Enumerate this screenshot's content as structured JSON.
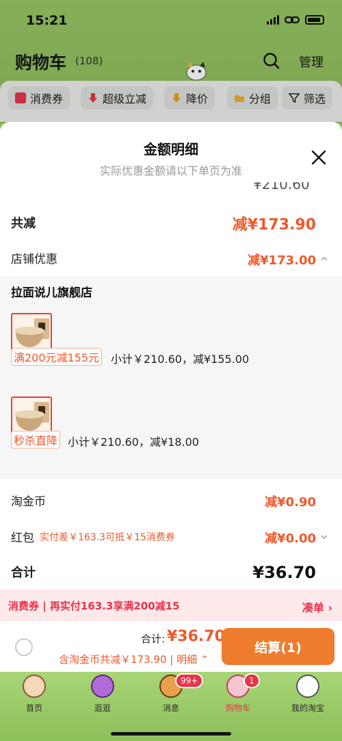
{
  "status": {
    "time": "15:21"
  },
  "header": {
    "title": "购物车",
    "count": "(108)",
    "manage": "管理"
  },
  "filters": [
    {
      "label": "消费券",
      "icon": "coupon-icon"
    },
    {
      "label": "超级立减",
      "icon": "arrow-down-icon"
    },
    {
      "label": "降价",
      "icon": "price-drop-icon"
    },
    {
      "label": "分组",
      "icon": "folder-icon"
    },
    {
      "label": "筛选",
      "icon": "filter-icon"
    }
  ],
  "sheet": {
    "title": "金额明细",
    "subtitle": "实际优惠金额请以下单页为准",
    "clipped_amount": "¥210.60",
    "total_reduce": {
      "label": "共减",
      "value": "减¥173.90"
    },
    "shop_discount": {
      "label": "店铺优惠",
      "value": "减¥173.00"
    },
    "shop": {
      "name": "拉面说儿旗舰店",
      "items": [
        {
          "tag": "满200元减155元",
          "subtotal": "小计￥210.60，减¥155.00"
        },
        {
          "tag": "秒杀直降",
          "subtotal": "小计￥210.60，减¥18.00"
        }
      ]
    },
    "taojinbi": {
      "label": "淘金币",
      "value": "减¥0.90"
    },
    "red_packet": {
      "label": "红包",
      "hint": "实付差￥163.3可抵￥15消费券",
      "value": "减¥0.00"
    },
    "sum": {
      "label": "合计",
      "value": "¥36.70"
    }
  },
  "coupon_bar": {
    "text": "消费券 | 再实付163.3享满200减15",
    "action": "凑单 ›"
  },
  "checkout": {
    "total_label": "合计:",
    "total_value": "¥36.70",
    "detail": "含淘金币共减￥173.90 | 明细 ⌃",
    "button": "结算(1)"
  },
  "tabs": [
    {
      "label": "首页"
    },
    {
      "label": "逛逛"
    },
    {
      "label": "消息",
      "badge": "99+"
    },
    {
      "label": "购物车",
      "badge": "1"
    },
    {
      "label": "我的淘宝"
    }
  ],
  "colors": {
    "accent": "#f0582a",
    "button": "#f07c2d",
    "coupon": "#e8344a",
    "bg": "#8fbe5c"
  }
}
